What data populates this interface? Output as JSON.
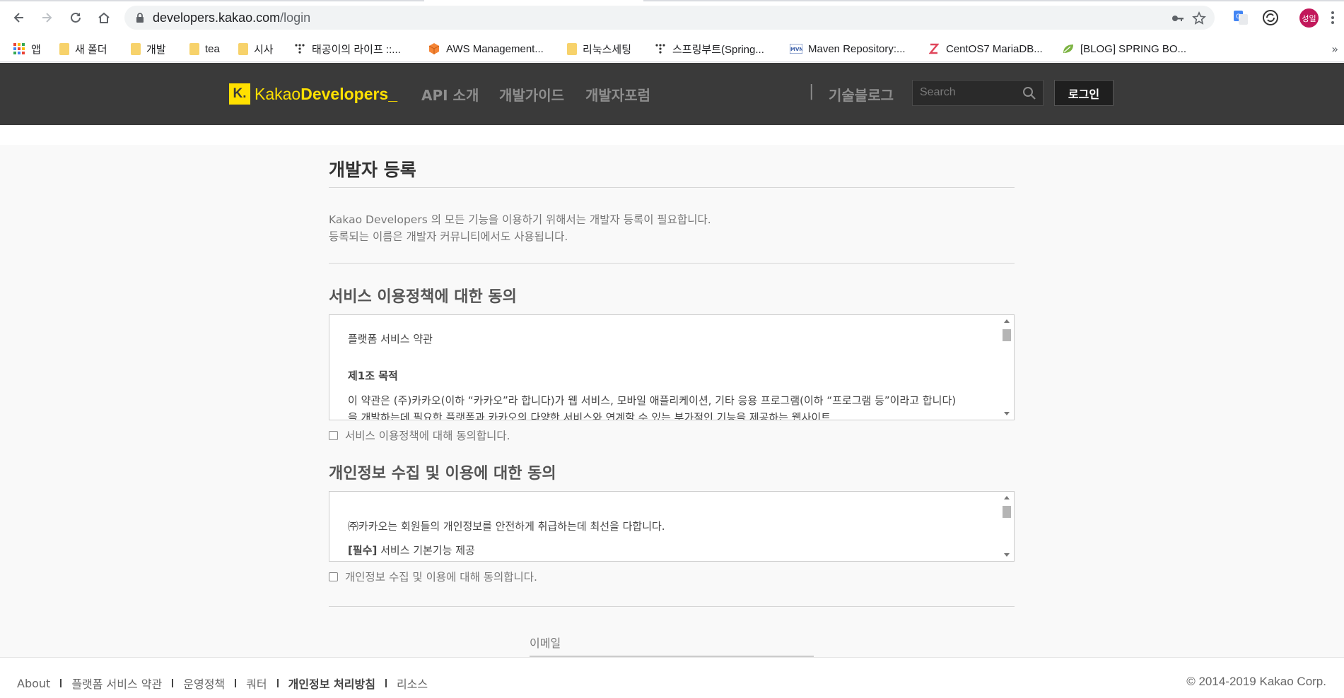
{
  "browser": {
    "url_host": "developers.kakao.com",
    "url_path": "/login",
    "avatar_text": "성일",
    "bookmarks": [
      {
        "label": "앱",
        "icon": "apps-grid-icon"
      },
      {
        "label": "새 폴더",
        "icon": "folder-icon"
      },
      {
        "label": "개발",
        "icon": "folder-icon"
      },
      {
        "label": "tea",
        "icon": "folder-icon"
      },
      {
        "label": "시사",
        "icon": "folder-icon"
      },
      {
        "label": "태공이의 라이프 ::...",
        "icon": "dots-icon"
      },
      {
        "label": "AWS Management...",
        "icon": "aws-cube-icon"
      },
      {
        "label": "리눅스세팅",
        "icon": "folder-icon"
      },
      {
        "label": "스프링부트(Spring...",
        "icon": "dots-icon"
      },
      {
        "label": "Maven Repository:...",
        "icon": "mvn-icon"
      },
      {
        "label": "CentOS7 MariaDB...",
        "icon": "z-icon"
      },
      {
        "label": "[BLOG] SPRING BO...",
        "icon": "leaf-icon"
      }
    ]
  },
  "header": {
    "logo_k": "K.",
    "logo_kakao": "Kakao",
    "logo_developers": "Developers_",
    "nav": [
      "API 소개",
      "개발가이드",
      "개발자포럼"
    ],
    "separator": "|",
    "tech_blog": "기술블로그",
    "search_placeholder": "Search",
    "login_label": "로그인",
    "colors": {
      "bg": "#3a3a3a",
      "accent": "#ffe000"
    }
  },
  "main": {
    "title": "개발자 등록",
    "intro_line1": "Kakao Developers 의 모든 기능을 이용하기 위해서는 개발자 등록이 필요합니다.",
    "intro_line2": "등록되는 이름은 개발자 커뮤니티에서도 사용됩니다.",
    "service_section": {
      "title": "서비스 이용정책에 대한 동의",
      "terms_title": "플랫폼 서비스 약관",
      "article_title": "제1조 목적",
      "article_line1": "이 약관은 (주)카카오(이하 “카카오”라 합니다)가 웹 서비스, 모바일 애플리케이션, 기타 응용 프로그램(이하 “프로그램 등”이라고 합니다)",
      "article_line2": "을 개발하는데 필요한 플랫폼과 카카오의 다양한 서비스와 연계할 수 있는 부가적인 기능을 제공하는 웹사이트",
      "agree_label": "서비스 이용정책에 대해 동의합니다."
    },
    "privacy_section": {
      "title": "개인정보 수집 및 이용에 대한 동의",
      "line1": "㈜카카오는 회원들의 개인정보를 안전하게 취급하는데 최선을 다합니다.",
      "required_tag": "[필수]",
      "line2": "서비스 기본기능 제공",
      "agree_label": "개인정보 수집 및 이용에 대해 동의합니다."
    },
    "email_label": "이메일"
  },
  "footer": {
    "links": [
      {
        "label": "About",
        "bold": false
      },
      {
        "label": "플랫폼 서비스 약관",
        "bold": false
      },
      {
        "label": "운영정책",
        "bold": false
      },
      {
        "label": "쿼터",
        "bold": false
      },
      {
        "label": "개인정보 처리방침",
        "bold": true
      },
      {
        "label": "리소스",
        "bold": false
      }
    ],
    "copyright": "© 2014-2019 Kakao Corp."
  }
}
